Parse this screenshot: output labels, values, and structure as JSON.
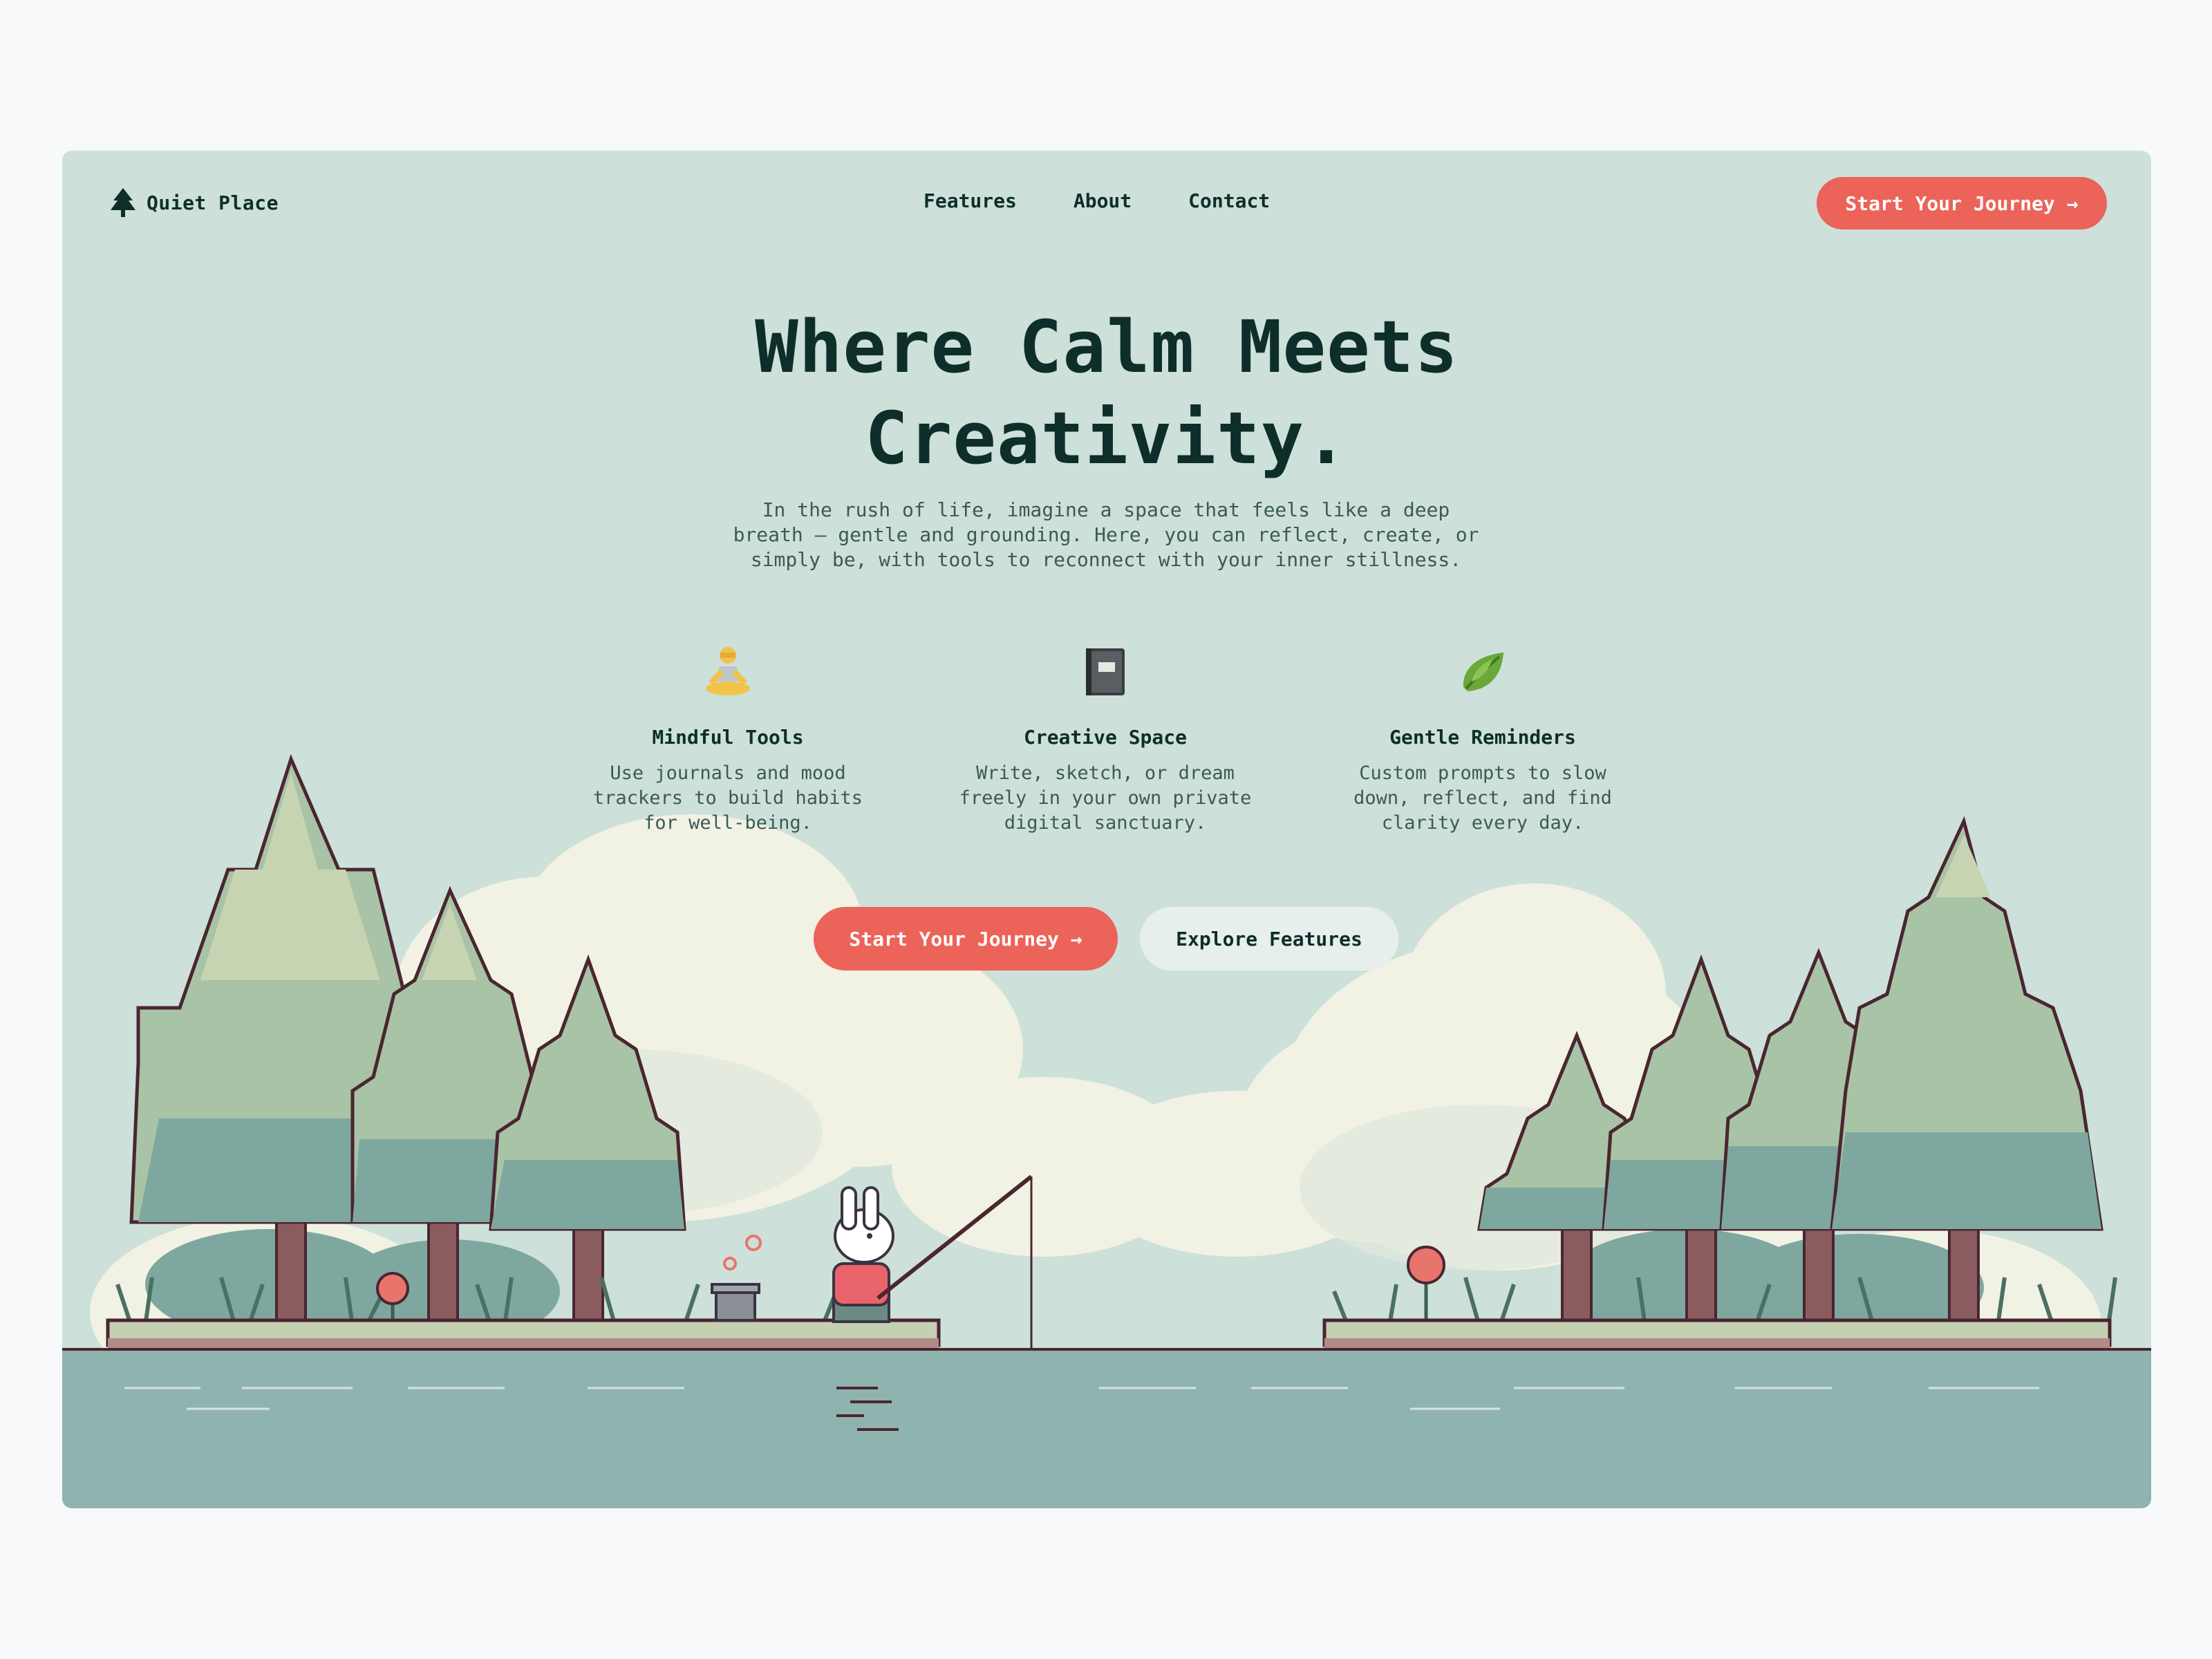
{
  "nav": {
    "logo_icon": "pine-tree-icon",
    "logo_text": "Quiet Place",
    "links": [
      {
        "label": "Features"
      },
      {
        "label": "About"
      },
      {
        "label": "Contact"
      }
    ],
    "cta_label": "Start Your Journey →"
  },
  "hero": {
    "title_line1": "Where Calm Meets",
    "title_line2": "Creativity.",
    "subtitle_line1": "In the rush of life, imagine a space that feels like a deep",
    "subtitle_line2": "breath — gentle and grounding. Here, you can reflect, create, or",
    "subtitle_line3": "simply be, with tools to reconnect with your inner stillness."
  },
  "features": [
    {
      "icon": "meditating-person-icon",
      "title": "Mindful Tools",
      "desc_line1": "Use journals and mood",
      "desc_line2": "trackers to build habits",
      "desc_line3": "for well-being."
    },
    {
      "icon": "notebook-icon",
      "title": "Creative Space",
      "desc_line1": "Write, sketch, or dream",
      "desc_line2": "freely in your own private",
      "desc_line3": "digital sanctuary."
    },
    {
      "icon": "leaf-icon",
      "title": "Gentle Reminders",
      "desc_line1": "Custom prompts to slow",
      "desc_line2": "down, reflect, and find",
      "desc_line3": "clarity every day."
    }
  ],
  "cta": {
    "primary_label": "Start Your Journey →",
    "secondary_label": "Explore Features"
  },
  "colors": {
    "background": "#cde0da",
    "accent": "#ec6359",
    "text": "#0e2e2a",
    "water": "#8fb3ae",
    "page": "#f8f9fb"
  }
}
